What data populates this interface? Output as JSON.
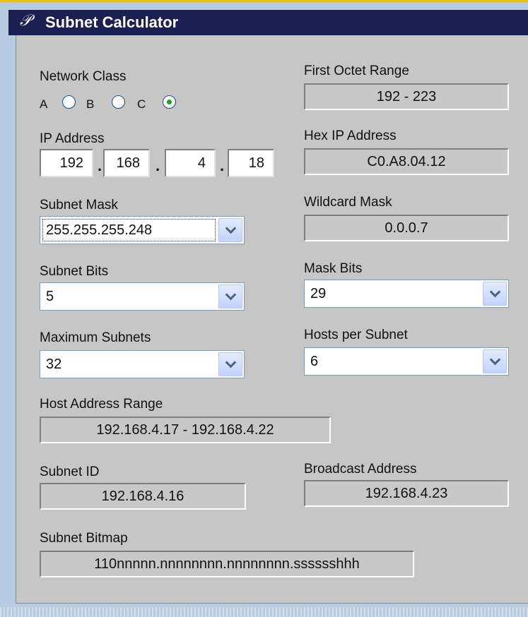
{
  "window": {
    "logo": "𝒫",
    "title": "Subnet Calculator"
  },
  "network_class": {
    "label": "Network Class",
    "options": [
      "A",
      "B",
      "C"
    ],
    "selected": "C"
  },
  "first_octet_range": {
    "label": "First Octet Range",
    "value": "192 - 223"
  },
  "ip_address": {
    "label": "IP Address",
    "octets": [
      "192",
      "168",
      "4",
      "18"
    ],
    "separator": "."
  },
  "hex_ip_address": {
    "label": "Hex IP Address",
    "value": "C0.A8.04.12"
  },
  "subnet_mask": {
    "label": "Subnet Mask",
    "value": "255.255.255.248"
  },
  "wildcard_mask": {
    "label": "Wildcard Mask",
    "value": "0.0.0.7"
  },
  "subnet_bits": {
    "label": "Subnet Bits",
    "value": "5"
  },
  "mask_bits": {
    "label": "Mask Bits",
    "value": "29"
  },
  "maximum_subnets": {
    "label": "Maximum Subnets",
    "value": "32"
  },
  "hosts_per_subnet": {
    "label": "Hosts per Subnet",
    "value": "6"
  },
  "host_address_range": {
    "label": "Host Address Range",
    "value": "192.168.4.17 - 192.168.4.22"
  },
  "subnet_id": {
    "label": "Subnet ID",
    "value": "192.168.4.16"
  },
  "broadcast_address": {
    "label": "Broadcast Address",
    "value": "192.168.4.23"
  },
  "subnet_bitmap": {
    "label": "Subnet Bitmap",
    "value": "110nnnnn.nnnnnnnn.nnnnnnnn.sssssshhh"
  },
  "icons": {
    "dropdown": "chevron-down-icon",
    "logo": "script-p-icon"
  },
  "colors": {
    "title_bar": "#1b2053",
    "panel": "#c6c6c6",
    "frame": "#b9cbe0",
    "accent_top": "#f2c200",
    "radio_selected": "#21a121"
  }
}
